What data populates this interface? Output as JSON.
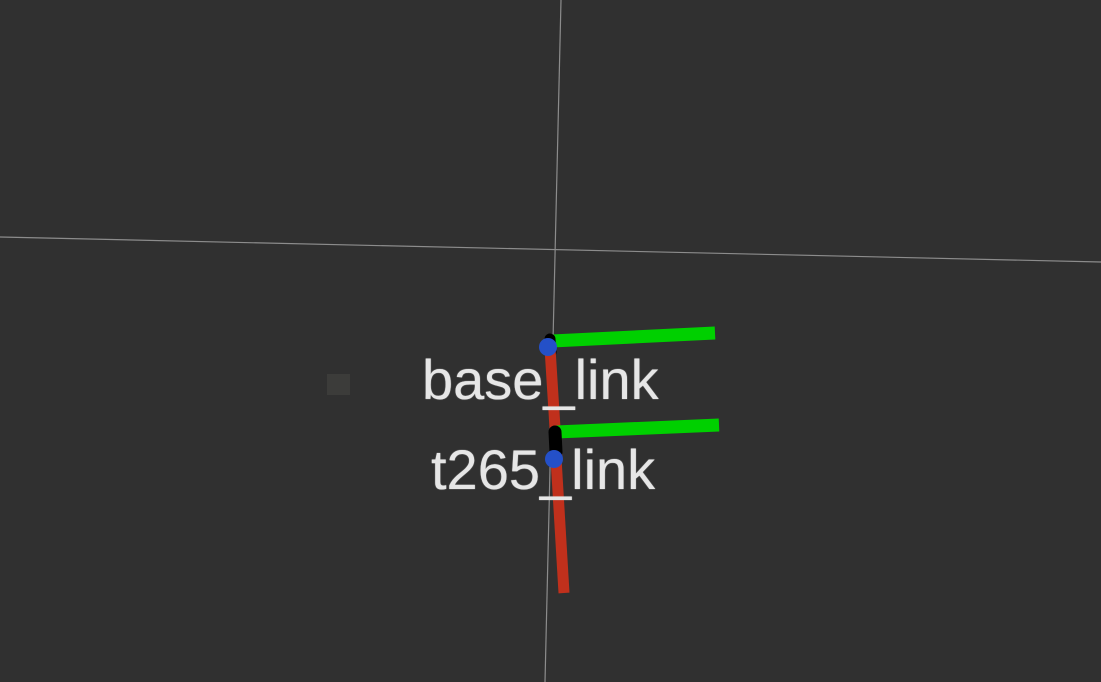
{
  "viewer": {
    "background_color": "#303030",
    "grid_color": "#9a9a9a"
  },
  "frames": [
    {
      "name": "base_link",
      "x_axis_color": "#c0301c",
      "y_axis_color": "#00d000",
      "origin_color": "#2450c8"
    },
    {
      "name": "t265_link",
      "x_axis_color": "#c0301c",
      "y_axis_color": "#00d000",
      "origin_color": "#2450c8"
    }
  ]
}
